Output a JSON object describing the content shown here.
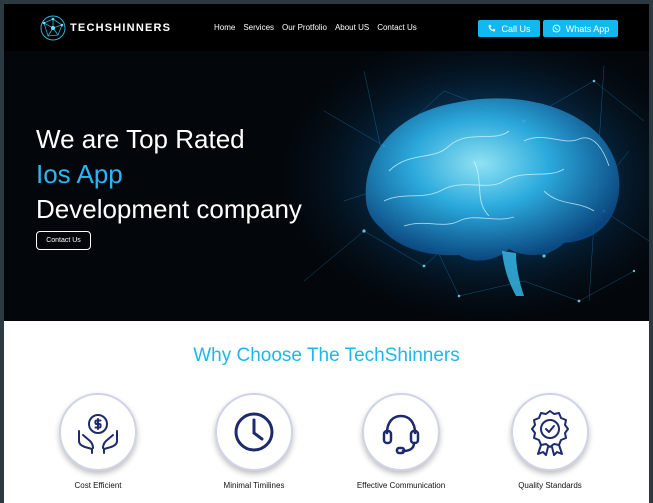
{
  "brand": {
    "name": "TECHSHINNERS"
  },
  "nav": {
    "items": [
      "Home",
      "Services",
      "Our Protfolio",
      "About US",
      "Contact Us"
    ]
  },
  "header_buttons": {
    "call": "Call Us",
    "whatsapp": "Whats App"
  },
  "hero": {
    "line1": "We are Top Rated",
    "line2": "Ios App",
    "line3": "Development company",
    "cta": "Contact Us",
    "accent": "#29b6f6",
    "image": "glowing-brain-network"
  },
  "why": {
    "title": "Why Choose The TechShinners",
    "features": [
      {
        "label": "Cost Efficient",
        "icon": "money-hands-icon"
      },
      {
        "label": "Minimal Timilines",
        "icon": "clock-icon"
      },
      {
        "label": "Effective Communication",
        "icon": "headset-icon"
      },
      {
        "label": "Quality Standards",
        "icon": "quality-badge-icon"
      }
    ]
  },
  "colors": {
    "cyan": "#12b8f0",
    "title": "#1eb7ea",
    "header_bg": "#000000",
    "icon": "#1d2a6e"
  }
}
